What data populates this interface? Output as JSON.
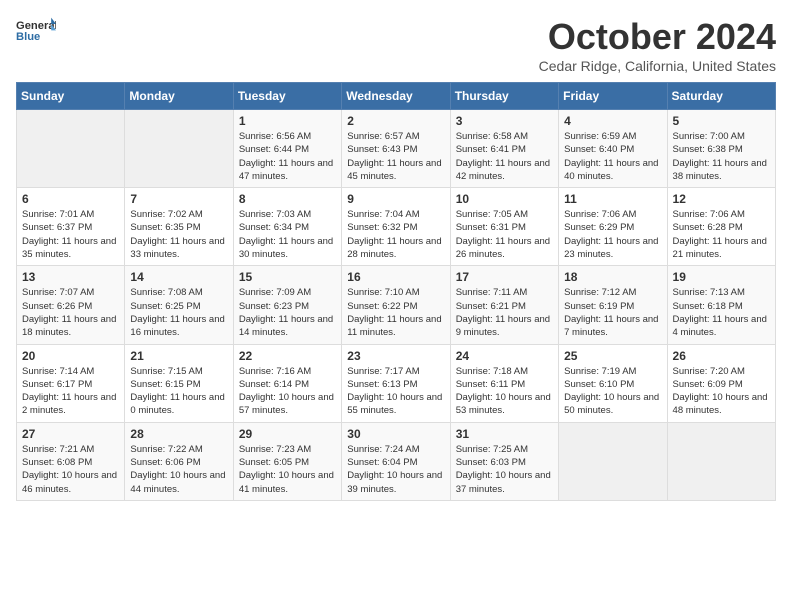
{
  "header": {
    "logo_general": "General",
    "logo_blue": "Blue",
    "month_title": "October 2024",
    "location": "Cedar Ridge, California, United States"
  },
  "weekdays": [
    "Sunday",
    "Monday",
    "Tuesday",
    "Wednesday",
    "Thursday",
    "Friday",
    "Saturday"
  ],
  "weeks": [
    [
      {
        "day": "",
        "sunrise": "",
        "sunset": "",
        "daylight": ""
      },
      {
        "day": "",
        "sunrise": "",
        "sunset": "",
        "daylight": ""
      },
      {
        "day": "1",
        "sunrise": "Sunrise: 6:56 AM",
        "sunset": "Sunset: 6:44 PM",
        "daylight": "Daylight: 11 hours and 47 minutes."
      },
      {
        "day": "2",
        "sunrise": "Sunrise: 6:57 AM",
        "sunset": "Sunset: 6:43 PM",
        "daylight": "Daylight: 11 hours and 45 minutes."
      },
      {
        "day": "3",
        "sunrise": "Sunrise: 6:58 AM",
        "sunset": "Sunset: 6:41 PM",
        "daylight": "Daylight: 11 hours and 42 minutes."
      },
      {
        "day": "4",
        "sunrise": "Sunrise: 6:59 AM",
        "sunset": "Sunset: 6:40 PM",
        "daylight": "Daylight: 11 hours and 40 minutes."
      },
      {
        "day": "5",
        "sunrise": "Sunrise: 7:00 AM",
        "sunset": "Sunset: 6:38 PM",
        "daylight": "Daylight: 11 hours and 38 minutes."
      }
    ],
    [
      {
        "day": "6",
        "sunrise": "Sunrise: 7:01 AM",
        "sunset": "Sunset: 6:37 PM",
        "daylight": "Daylight: 11 hours and 35 minutes."
      },
      {
        "day": "7",
        "sunrise": "Sunrise: 7:02 AM",
        "sunset": "Sunset: 6:35 PM",
        "daylight": "Daylight: 11 hours and 33 minutes."
      },
      {
        "day": "8",
        "sunrise": "Sunrise: 7:03 AM",
        "sunset": "Sunset: 6:34 PM",
        "daylight": "Daylight: 11 hours and 30 minutes."
      },
      {
        "day": "9",
        "sunrise": "Sunrise: 7:04 AM",
        "sunset": "Sunset: 6:32 PM",
        "daylight": "Daylight: 11 hours and 28 minutes."
      },
      {
        "day": "10",
        "sunrise": "Sunrise: 7:05 AM",
        "sunset": "Sunset: 6:31 PM",
        "daylight": "Daylight: 11 hours and 26 minutes."
      },
      {
        "day": "11",
        "sunrise": "Sunrise: 7:06 AM",
        "sunset": "Sunset: 6:29 PM",
        "daylight": "Daylight: 11 hours and 23 minutes."
      },
      {
        "day": "12",
        "sunrise": "Sunrise: 7:06 AM",
        "sunset": "Sunset: 6:28 PM",
        "daylight": "Daylight: 11 hours and 21 minutes."
      }
    ],
    [
      {
        "day": "13",
        "sunrise": "Sunrise: 7:07 AM",
        "sunset": "Sunset: 6:26 PM",
        "daylight": "Daylight: 11 hours and 18 minutes."
      },
      {
        "day": "14",
        "sunrise": "Sunrise: 7:08 AM",
        "sunset": "Sunset: 6:25 PM",
        "daylight": "Daylight: 11 hours and 16 minutes."
      },
      {
        "day": "15",
        "sunrise": "Sunrise: 7:09 AM",
        "sunset": "Sunset: 6:23 PM",
        "daylight": "Daylight: 11 hours and 14 minutes."
      },
      {
        "day": "16",
        "sunrise": "Sunrise: 7:10 AM",
        "sunset": "Sunset: 6:22 PM",
        "daylight": "Daylight: 11 hours and 11 minutes."
      },
      {
        "day": "17",
        "sunrise": "Sunrise: 7:11 AM",
        "sunset": "Sunset: 6:21 PM",
        "daylight": "Daylight: 11 hours and 9 minutes."
      },
      {
        "day": "18",
        "sunrise": "Sunrise: 7:12 AM",
        "sunset": "Sunset: 6:19 PM",
        "daylight": "Daylight: 11 hours and 7 minutes."
      },
      {
        "day": "19",
        "sunrise": "Sunrise: 7:13 AM",
        "sunset": "Sunset: 6:18 PM",
        "daylight": "Daylight: 11 hours and 4 minutes."
      }
    ],
    [
      {
        "day": "20",
        "sunrise": "Sunrise: 7:14 AM",
        "sunset": "Sunset: 6:17 PM",
        "daylight": "Daylight: 11 hours and 2 minutes."
      },
      {
        "day": "21",
        "sunrise": "Sunrise: 7:15 AM",
        "sunset": "Sunset: 6:15 PM",
        "daylight": "Daylight: 11 hours and 0 minutes."
      },
      {
        "day": "22",
        "sunrise": "Sunrise: 7:16 AM",
        "sunset": "Sunset: 6:14 PM",
        "daylight": "Daylight: 10 hours and 57 minutes."
      },
      {
        "day": "23",
        "sunrise": "Sunrise: 7:17 AM",
        "sunset": "Sunset: 6:13 PM",
        "daylight": "Daylight: 10 hours and 55 minutes."
      },
      {
        "day": "24",
        "sunrise": "Sunrise: 7:18 AM",
        "sunset": "Sunset: 6:11 PM",
        "daylight": "Daylight: 10 hours and 53 minutes."
      },
      {
        "day": "25",
        "sunrise": "Sunrise: 7:19 AM",
        "sunset": "Sunset: 6:10 PM",
        "daylight": "Daylight: 10 hours and 50 minutes."
      },
      {
        "day": "26",
        "sunrise": "Sunrise: 7:20 AM",
        "sunset": "Sunset: 6:09 PM",
        "daylight": "Daylight: 10 hours and 48 minutes."
      }
    ],
    [
      {
        "day": "27",
        "sunrise": "Sunrise: 7:21 AM",
        "sunset": "Sunset: 6:08 PM",
        "daylight": "Daylight: 10 hours and 46 minutes."
      },
      {
        "day": "28",
        "sunrise": "Sunrise: 7:22 AM",
        "sunset": "Sunset: 6:06 PM",
        "daylight": "Daylight: 10 hours and 44 minutes."
      },
      {
        "day": "29",
        "sunrise": "Sunrise: 7:23 AM",
        "sunset": "Sunset: 6:05 PM",
        "daylight": "Daylight: 10 hours and 41 minutes."
      },
      {
        "day": "30",
        "sunrise": "Sunrise: 7:24 AM",
        "sunset": "Sunset: 6:04 PM",
        "daylight": "Daylight: 10 hours and 39 minutes."
      },
      {
        "day": "31",
        "sunrise": "Sunrise: 7:25 AM",
        "sunset": "Sunset: 6:03 PM",
        "daylight": "Daylight: 10 hours and 37 minutes."
      },
      {
        "day": "",
        "sunrise": "",
        "sunset": "",
        "daylight": ""
      },
      {
        "day": "",
        "sunrise": "",
        "sunset": "",
        "daylight": ""
      }
    ]
  ]
}
